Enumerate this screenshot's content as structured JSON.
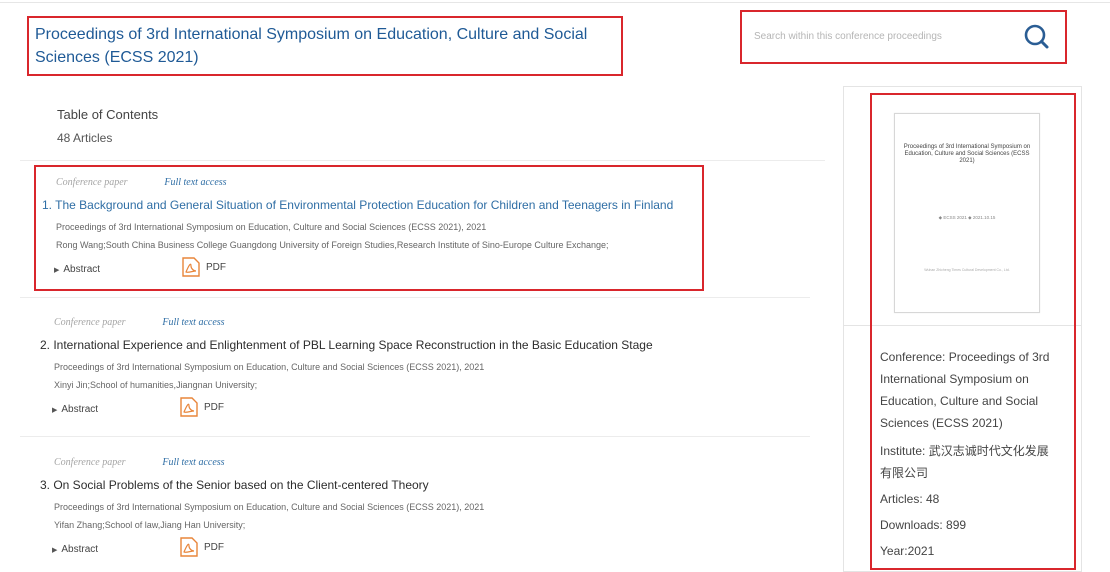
{
  "header": {
    "title": "Proceedings of 3rd International Symposium on Education, Culture and Social Sciences (ECSS 2021)"
  },
  "search": {
    "placeholder": "Search within this conference proceedings"
  },
  "toc": {
    "heading": "Table of Contents",
    "count": "48 Articles"
  },
  "articles": [
    {
      "type": "Conference paper",
      "access": "Full text access",
      "title": "1. The Background and General Situation of Environmental Protection Education for Children and Teenagers in Finland",
      "proceedings": "Proceedings of 3rd International Symposium on Education, Culture and Social Sciences (ECSS 2021), 2021",
      "authors": "Rong Wang;South China Business College Guangdong University of Foreign Studies,Research Institute of Sino-Europe Culture Exchange;",
      "abstract_label": "Abstract",
      "pdf_label": "PDF"
    },
    {
      "type": "Conference paper",
      "access": "Full text access",
      "title": "2. International Experience and Enlightenment of PBL Learning Space Reconstruction in the Basic Education Stage",
      "proceedings": "Proceedings of 3rd International Symposium on Education, Culture and Social Sciences (ECSS 2021), 2021",
      "authors": "Xinyi Jin;School of humanities,Jiangnan University;",
      "abstract_label": "Abstract",
      "pdf_label": "PDF"
    },
    {
      "type": "Conference paper",
      "access": "Full text access",
      "title": "3. On Social Problems of the Senior based on the Client-centered Theory",
      "proceedings": "Proceedings of 3rd International Symposium on Education, Culture and Social Sciences (ECSS 2021), 2021",
      "authors": "Yifan Zhang;School of law,Jiang Han University;",
      "abstract_label": "Abstract",
      "pdf_label": "PDF"
    }
  ],
  "cover": {
    "title": "Proceedings of 3rd International Symposium on Education, Culture and Social Sciences (ECSS 2021)",
    "date_line": "◆ ECSS 2021 ◆    2021.10.15",
    "publisher_line": "Wuhan Zhicheng Times Cultural Development Co., Ltd."
  },
  "info": {
    "conference": "Conference: Proceedings of 3rd International Symposium on Education, Culture and Social Sciences (ECSS 2021)",
    "institute": "Institute: 武汉志诚时代文化发展有限公司",
    "articles": "Articles: 48",
    "downloads": "Downloads: 899",
    "year": "Year:2021"
  },
  "colors": {
    "accent_red": "#d9262c",
    "link_blue": "#2f6ea5",
    "title_blue": "#1f5a96",
    "pdf_orange": "#e8853a"
  },
  "icons": {
    "search": "search-icon",
    "pdf": "pdf-icon",
    "expand": "triangle-right-icon"
  }
}
